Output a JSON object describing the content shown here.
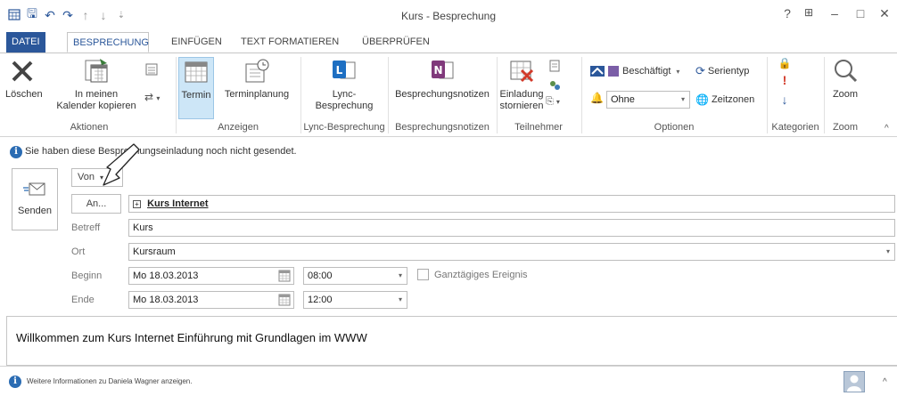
{
  "window": {
    "title": "Kurs - Besprechung",
    "help": "?",
    "restore_ribbon": "⊞",
    "minimize": "–",
    "maximize": "□",
    "close": "✕"
  },
  "qat": {
    "save": "🖫",
    "undo": "↶",
    "redo": "↷",
    "up": "↑",
    "down": "↓",
    "more": "⇣"
  },
  "tabs": [
    "DATEI",
    "BESPRECHUNG",
    "EINFÜGEN",
    "TEXT FORMATIEREN",
    "ÜBERPRÜFEN"
  ],
  "ribbon": {
    "aktionen": {
      "group": "Aktionen",
      "delete": "Löschen",
      "copy_line1": "In meinen",
      "copy_line2": "Kalender kopieren"
    },
    "anzeigen": {
      "group": "Anzeigen",
      "termin": "Termin",
      "terminplanung": "Terminplanung"
    },
    "lync": {
      "group": "Lync-Besprechung",
      "line1": "Lync-",
      "line2": "Besprechung"
    },
    "notizen": {
      "group": "Besprechungsnotizen",
      "label": "Besprechungsnotizen"
    },
    "teilnehmer": {
      "group": "Teilnehmer",
      "line1": "Einladung",
      "line2": "stornieren"
    },
    "optionen": {
      "group": "Optionen",
      "status": "Beschäftigt",
      "reminder": "Ohne",
      "serientyp": "Serientyp",
      "zeitzonen": "Zeitzonen"
    },
    "kategorien": {
      "group": "Kategorien"
    },
    "zoom": {
      "group": "Zoom",
      "label": "Zoom"
    },
    "collapse": "^"
  },
  "infobar": {
    "text": "Sie haben diese Besprechungseinladung noch nicht gesendet."
  },
  "form": {
    "send": "Senden",
    "from": "Von",
    "to_button": "An...",
    "to_value": "Kurs Internet",
    "subject_label": "Betreff",
    "subject_value": "Kurs",
    "location_label": "Ort",
    "location_value": "Kursraum",
    "start_label": "Beginn",
    "start_date": "Mo 18.03.2013",
    "start_time": "08:00",
    "allday": "Ganztägiges Ereignis",
    "end_label": "Ende",
    "end_date": "Mo 18.03.2013",
    "end_time": "12:00"
  },
  "body_text": "Willkommen zum Kurs Internet Einführung mit Grundlagen im WWW",
  "footer": {
    "text": "Weitere Informationen zu Daniela Wagner anzeigen.",
    "expand": "^"
  },
  "colors": {
    "accent": "#2b579a",
    "active_button": "#cde6f7",
    "info": "#2b6cb3"
  }
}
